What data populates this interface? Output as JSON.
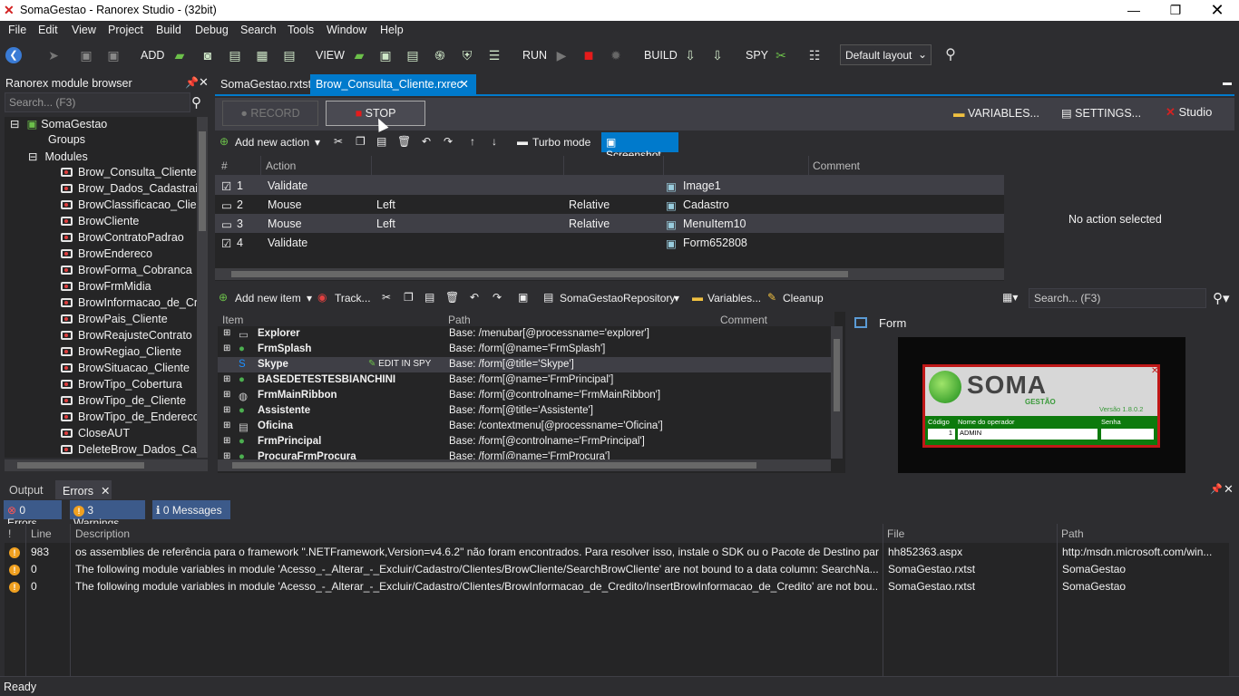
{
  "window": {
    "title": "SomaGestao - Ranorex Studio - (32bit)"
  },
  "menu": [
    "File",
    "Edit",
    "View",
    "Project",
    "Build",
    "Debug",
    "Search",
    "Tools",
    "Window",
    "Help"
  ],
  "toolbar": {
    "add": "ADD",
    "view": "VIEW",
    "run": "RUN",
    "build": "BUILD",
    "spy": "SPY",
    "layout": "Default layout"
  },
  "module_browser": {
    "title": "Ranorex module browser",
    "search_placeholder": "Search... (F3)",
    "root": "SomaGestao",
    "groups": "Groups",
    "modules": "Modules",
    "items": [
      "Brow_Consulta_Cliente",
      "Brow_Dados_Cadastrais",
      "BrowClassificacao_Clien",
      "BrowCliente",
      "BrowContratoPadrao",
      "BrowEndereco",
      "BrowForma_Cobranca",
      "BrowFrmMidia",
      "BrowInformacao_de_Cre",
      "BrowPais_Cliente",
      "BrowReajusteContrato",
      "BrowRegiao_Cliente",
      "BrowSituacao_Cliente",
      "BrowTipo_Cobertura",
      "BrowTipo_de_Cliente",
      "BrowTipo_de_Endereco",
      "CloseAUT",
      "DeleteBrow_Dados_Cada"
    ]
  },
  "tabs": {
    "tab1": "SomaGestao.rxtst",
    "tab2": "Brow_Consulta_Cliente.rxrec"
  },
  "recorder": {
    "record": "RECORD",
    "stop": "STOP",
    "variables": "VARIABLES...",
    "settings": "SETTINGS...",
    "studio": "Studio"
  },
  "action_toolbar": {
    "add_action": "Add new action",
    "turbo": "Turbo mode",
    "screenshot": "Screenshot"
  },
  "action_table": {
    "headers": {
      "num": "#",
      "action": "Action",
      "comment": "Comment"
    },
    "rows": [
      {
        "n": "1",
        "action": "Validate",
        "a2": "",
        "a3": "",
        "item": "Image1"
      },
      {
        "n": "2",
        "action": "Mouse",
        "a2": "Left",
        "a3": "Relative",
        "item": "Cadastro"
      },
      {
        "n": "3",
        "action": "Mouse",
        "a2": "Left",
        "a3": "Relative",
        "item": "MenuItem10"
      },
      {
        "n": "4",
        "action": "Validate",
        "a2": "",
        "a3": "",
        "item": "Form652808"
      }
    ]
  },
  "no_action": "No action selected",
  "repo_toolbar": {
    "add_item": "Add new item",
    "track": "Track...",
    "repo": "SomaGestaoRepository",
    "variables": "Variables...",
    "cleanup": "Cleanup",
    "search_placeholder": "Search... (F3)"
  },
  "repo_table": {
    "headers": {
      "item": "Item",
      "path": "Path",
      "comment": "Comment"
    },
    "edit_in_spy": "EDIT IN SPY",
    "rows": [
      {
        "item": "Explorer",
        "path": "Base: /menubar[@processname='explorer']"
      },
      {
        "item": "FrmSplash",
        "path": "Base: /form[@name='FrmSplash']"
      },
      {
        "item": "Skype",
        "path": "Base: /form[@title='Skype']"
      },
      {
        "item": "BASEDETESTESBIANCHINI",
        "path": "Base: /form[@name='FrmPrincipal']"
      },
      {
        "item": "FrmMainRibbon",
        "path": "Base: /form[@controlname='FrmMainRibbon']"
      },
      {
        "item": "Assistente",
        "path": "Base: /form[@title='Assistente']"
      },
      {
        "item": "Oficina",
        "path": "Base: /contextmenu[@processname='Oficina']"
      },
      {
        "item": "FrmPrincipal",
        "path": "Base: /form[@controlname='FrmPrincipal']"
      },
      {
        "item": "ProcuraFrmProcura",
        "path": "Base: /form[@name='FrmProcura']"
      }
    ]
  },
  "preview": {
    "title": "Form",
    "brand": "SOMA",
    "sub": "GESTÃO",
    "version": "Versão 1.8.0.2",
    "codigo": "Código",
    "operador": "Nome do operador",
    "senha": "Senha",
    "cod_val": "1",
    "op_val": "ADMIN"
  },
  "bottom": {
    "output": "Output",
    "errors": "Errors",
    "errors_btn": "0 Errors",
    "warnings_btn": "3 Warnings",
    "messages_btn": "0 Messages",
    "headers": {
      "bang": "!",
      "line": "Line",
      "desc": "Description",
      "file": "File",
      "path": "Path"
    },
    "rows": [
      {
        "line": "983",
        "desc": "os assemblies de referência para o framework \".NETFramework,Version=v4.6.2\" não foram encontrados. Para resolver isso, instale o SDK ou o Pacote de Destino para e...",
        "file": "hh852363.aspx",
        "path": "http:/msdn.microsoft.com/win..."
      },
      {
        "line": "0",
        "desc": "The following module variables in module 'Acesso_-_Alterar_-_Excluir/Cadastro/Clientes/BrowCliente/SearchBrowCliente' are not bound to a data column: SearchNa...",
        "file": "SomaGestao.rxtst",
        "path": "SomaGestao"
      },
      {
        "line": "0",
        "desc": "The following module variables in module 'Acesso_-_Alterar_-_Excluir/Cadastro/Clientes/BrowInformacao_de_Credito/InsertBrowInformacao_de_Credito' are not bou...",
        "file": "SomaGestao.rxtst",
        "path": "SomaGestao"
      }
    ]
  },
  "status": "Ready",
  "colors": {
    "accent": "#007acc",
    "bg": "#2d2d30",
    "panel": "#252526"
  }
}
